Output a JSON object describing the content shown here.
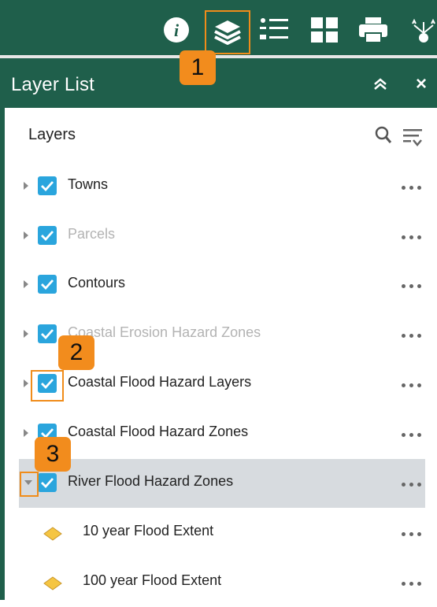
{
  "toolbar": {
    "icons": [
      "info-icon",
      "layers-icon",
      "legend-icon",
      "basemap-gallery-icon",
      "print-icon",
      "share-icon"
    ],
    "active": "layers-icon"
  },
  "callouts": [
    "1",
    "2",
    "3"
  ],
  "panel": {
    "title": "Layer List",
    "collapse_icon": "chevron-double-up-icon",
    "close_label": "×"
  },
  "layers_section": {
    "heading": "Layers"
  },
  "layers": [
    {
      "label": "Towns",
      "checked": true,
      "dimmed": false,
      "expanded": false
    },
    {
      "label": "Parcels",
      "checked": true,
      "dimmed": true,
      "expanded": false
    },
    {
      "label": "Contours",
      "checked": true,
      "dimmed": false,
      "expanded": false
    },
    {
      "label": "Coastal Erosion Hazard Zones",
      "checked": true,
      "dimmed": true,
      "expanded": false
    },
    {
      "label": "Coastal Flood Hazard Layers",
      "checked": true,
      "dimmed": false,
      "expanded": false
    },
    {
      "label": "Coastal Flood Hazard Zones",
      "checked": true,
      "dimmed": false,
      "expanded": false
    },
    {
      "label": "River Flood Hazard Zones",
      "checked": true,
      "dimmed": false,
      "expanded": true,
      "selected": true
    }
  ],
  "sublayers": [
    {
      "label": "10 year Flood Extent",
      "swatch_color": "#f5c542"
    },
    {
      "label": "100 year Flood Extent",
      "swatch_color": "#f5c542"
    }
  ],
  "colors": {
    "header_bg": "#1f5f4b",
    "checkbox": "#2aa5dd",
    "callout": "#f28c1d",
    "selected_row": "#d7dbdf"
  }
}
